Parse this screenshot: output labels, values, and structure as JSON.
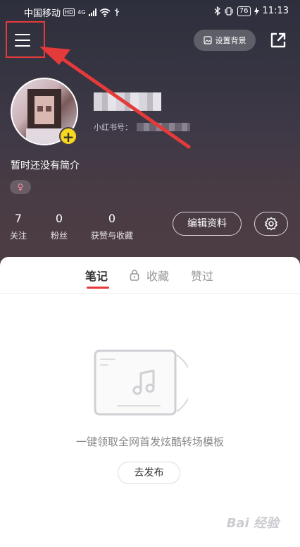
{
  "status_bar": {
    "carrier": "中国移动",
    "hd_badge": "HD",
    "network": "4G",
    "battery": "76",
    "time": "11:13"
  },
  "top_bar": {
    "set_background_label": "设置背景"
  },
  "profile": {
    "xhs_id_label": "小红书号：",
    "bio": "暂时还没有简介",
    "gender_symbol": "♀",
    "stats": [
      {
        "value": "7",
        "label": "关注"
      },
      {
        "value": "0",
        "label": "粉丝"
      },
      {
        "value": "0",
        "label": "获赞与收藏"
      }
    ],
    "edit_label": "编辑资料"
  },
  "tabs": [
    {
      "label": "笔记",
      "active": true
    },
    {
      "label": "收藏",
      "active": false
    },
    {
      "label": "赞过",
      "active": false
    }
  ],
  "empty_state": {
    "message": "一键领取全网首发炫酷转场模板",
    "publish_label": "去发布"
  },
  "watermark": "Bai 经验",
  "colors": {
    "accent_red": "#e53a3a",
    "plus_yellow": "#f5d81f",
    "header_bg": "#3d3846"
  }
}
